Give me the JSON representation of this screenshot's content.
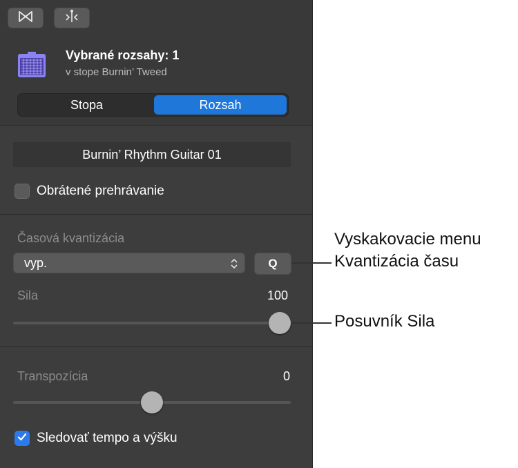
{
  "toolbar": {
    "buttons": [
      {
        "icon": "bowtie-icon"
      },
      {
        "icon": "split-at-playhead-icon"
      }
    ]
  },
  "header": {
    "icon": "amplifier-icon",
    "title": "Vybrané rozsahy: 1",
    "subtitle": "v stope Burnin’ Tweed",
    "tabs": [
      {
        "label": "Stopa",
        "selected": false
      },
      {
        "label": "Rozsah",
        "selected": true
      }
    ]
  },
  "region": {
    "name": "Burnin’ Rhythm Guitar 01",
    "reverse_label": "Obrátené prehrávanie",
    "reverse_checked": false
  },
  "quantize": {
    "section_label": "Časová kvantizácia",
    "selected_value": "vyp.",
    "q_button_label": "Q",
    "strength_label": "Sila",
    "strength_value": "100",
    "strength_fraction": 1.0
  },
  "transpose": {
    "label": "Transpozícia",
    "value": "0",
    "slider_fraction": 0.5
  },
  "follow": {
    "label": "Sledovať tempo a výšku",
    "checked": true
  },
  "callouts": {
    "quantize_menu_line1": "Vyskakovacie menu",
    "quantize_menu_line2": "Kvantizácia času",
    "strength_slider": "Posuvník Sila"
  },
  "colors": {
    "accent": "#1f77d9",
    "checkbox_on": "#2b7bea",
    "amp_icon": "#8a84f0"
  }
}
